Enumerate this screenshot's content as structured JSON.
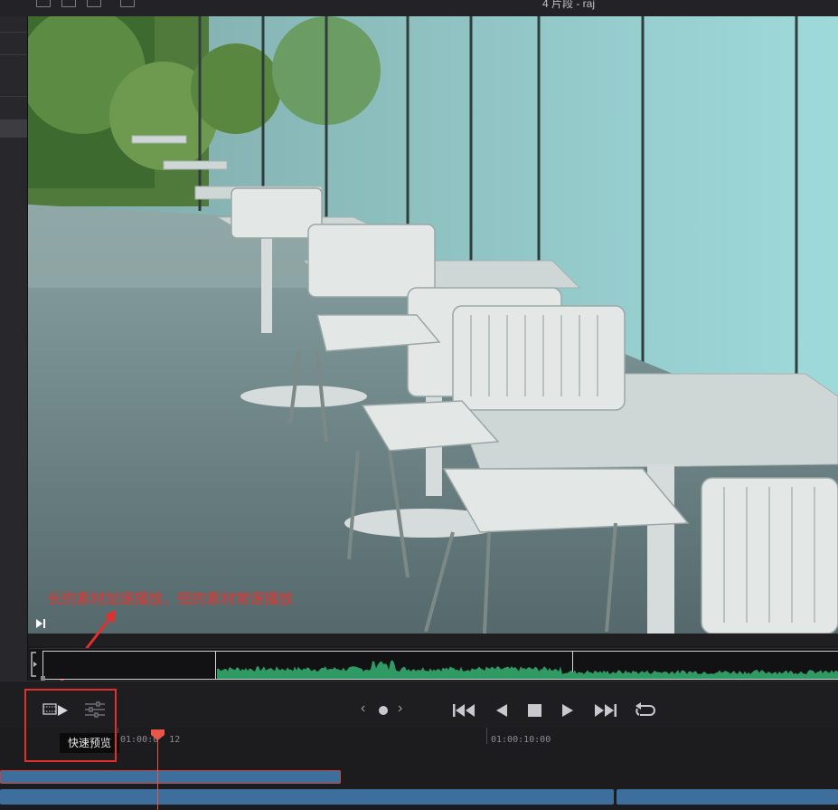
{
  "window": {
    "title": "4 片段 - raj"
  },
  "viewer": {
    "caption": "长的素材加速播放，短的素材常速播放",
    "image_description_icon": "cafeteria-scene"
  },
  "transport": {
    "quick_preview_tooltip": "快速预览",
    "quick_preview_icon": "film-play-icon",
    "settings_icon": "sliders-icon",
    "nav_prev_icon": "chevron-left-icon",
    "nav_dot_icon": "dot-icon",
    "nav_next_icon": "chevron-right-icon",
    "first_frame_icon": "skip-start-icon",
    "play_reverse_icon": "play-reverse-icon",
    "stop_icon": "stop-icon",
    "play_icon": "play-icon",
    "last_frame_icon": "skip-end-icon",
    "loop_icon": "loop-icon"
  },
  "timeline": {
    "timecodes": [
      "01:00:0  12",
      "01:00:10:00"
    ]
  },
  "colors": {
    "annotation": "#e3302c",
    "clip": "#3e6f9c",
    "playhead": "#e8564a",
    "waveform": "#2f9a63"
  }
}
